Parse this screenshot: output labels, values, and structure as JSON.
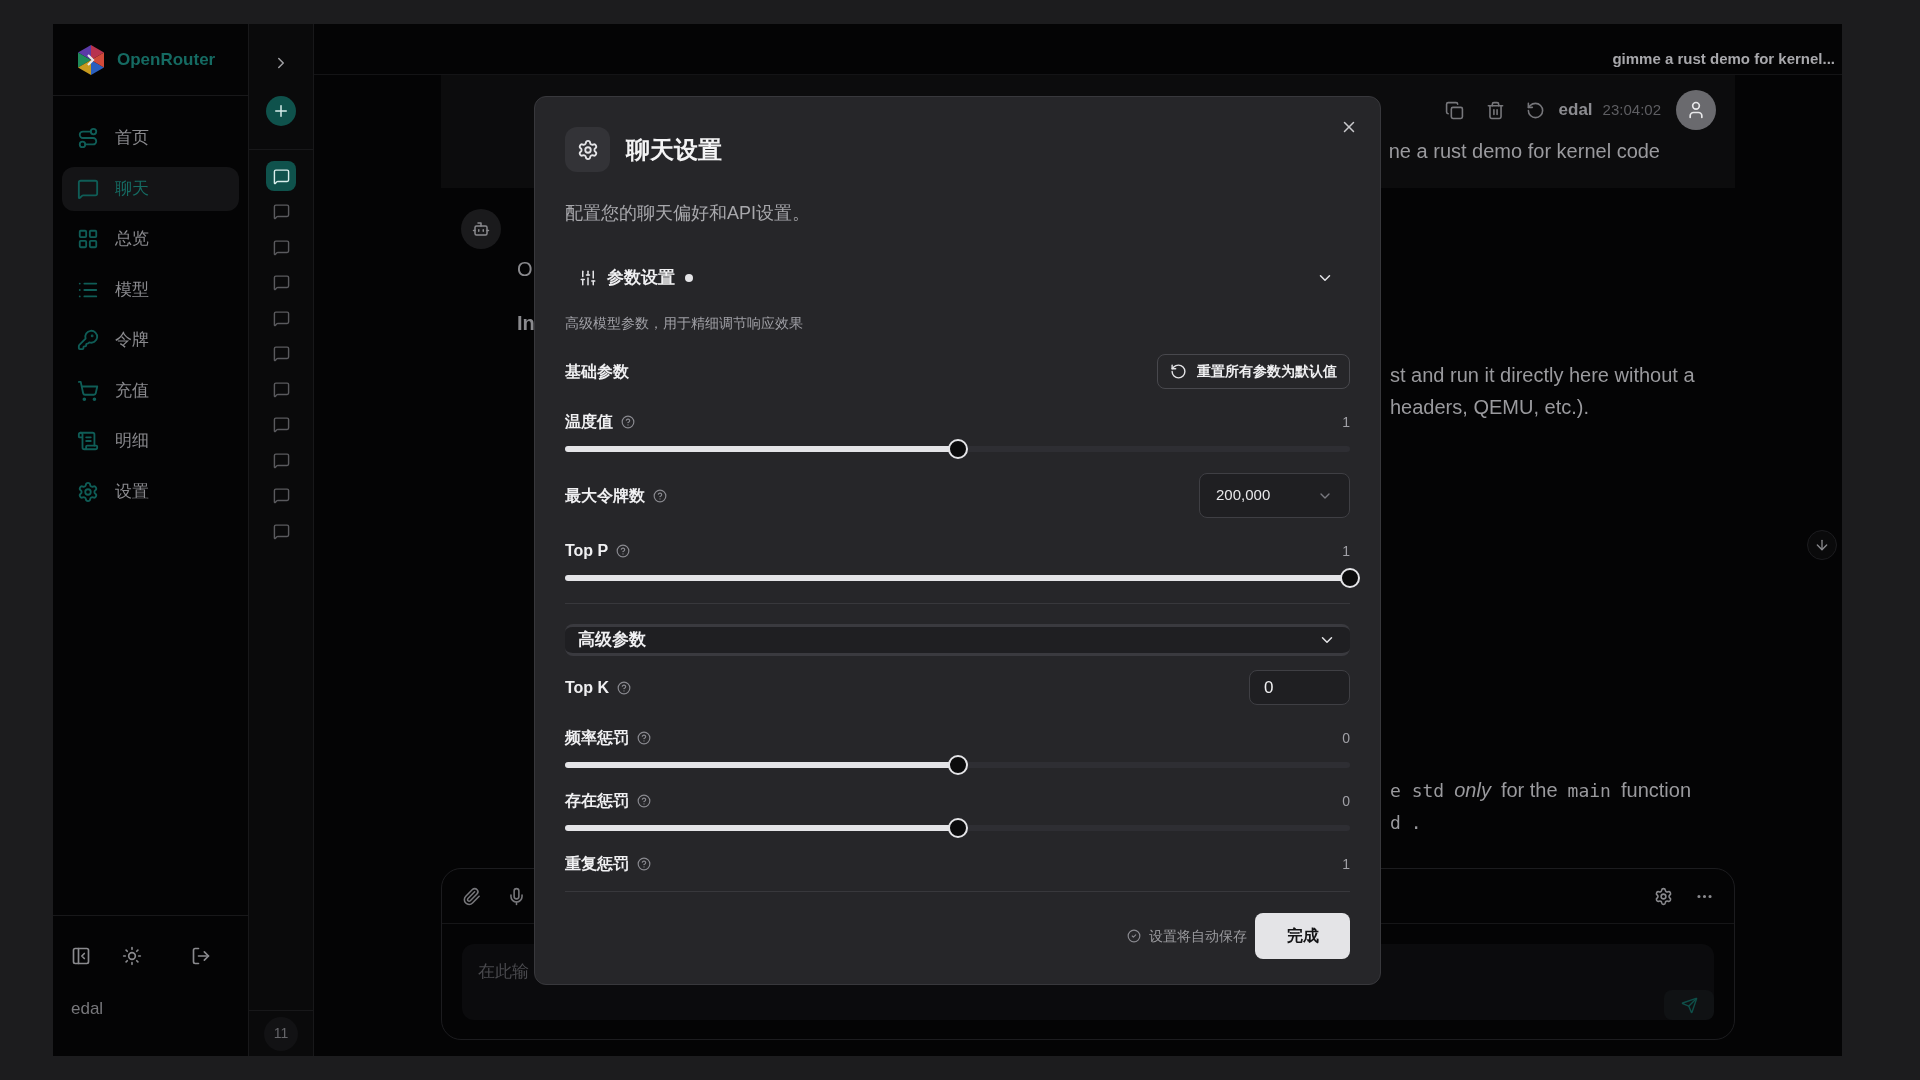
{
  "brand": "OpenRouter",
  "sidebar": {
    "items": [
      {
        "kind": "home",
        "label": "首页",
        "selected": false
      },
      {
        "kind": "chat",
        "label": "聊天",
        "selected": true
      },
      {
        "kind": "overview",
        "label": "总览",
        "selected": false
      },
      {
        "kind": "models",
        "label": "模型",
        "selected": false
      },
      {
        "kind": "tokens",
        "label": "令牌",
        "selected": false
      },
      {
        "kind": "topup",
        "label": "充值",
        "selected": false
      },
      {
        "kind": "details",
        "label": "明细",
        "selected": false
      },
      {
        "kind": "settings",
        "label": "设置",
        "selected": false
      }
    ],
    "user": "edal"
  },
  "chat_list": {
    "count": "11",
    "items": [
      {
        "selected": true
      },
      {
        "selected": false
      },
      {
        "selected": false
      },
      {
        "selected": false
      },
      {
        "selected": false
      },
      {
        "selected": false
      },
      {
        "selected": false
      },
      {
        "selected": false
      },
      {
        "selected": false
      },
      {
        "selected": false
      },
      {
        "selected": false
      }
    ]
  },
  "header": {
    "title": "gimme a rust demo for kernel..."
  },
  "user_message": {
    "author": "edal",
    "time": "23:04:02",
    "text": "ne a rust demo for kernel code"
  },
  "assistant_message": {
    "left_fragments": [
      {
        "kind": "text",
        "text": "O"
      },
      {
        "kind": "heading",
        "text": "In"
      }
    ],
    "blocks": [
      {
        "lines": [
          [
            {
              "kind": "text",
              "text": "st and run it directly here without a"
            }
          ],
          [
            {
              "kind": "text",
              "text": "headers, QEMU, etc.)."
            }
          ]
        ]
      },
      {
        "lines": [
          [
            {
              "kind": "code",
              "text": "e std"
            },
            {
              "kind": "italic",
              "text": "only"
            },
            {
              "kind": "text",
              "text": "for the"
            },
            {
              "kind": "code",
              "text": "main"
            },
            {
              "kind": "text",
              "text": "function"
            }
          ],
          [
            {
              "kind": "code",
              "text": "d"
            },
            {
              "kind": "code",
              "text": "."
            }
          ]
        ]
      }
    ]
  },
  "composer": {
    "placeholder": "在此输"
  },
  "dialog": {
    "title": "聊天设置",
    "description": "配置您的聊天偏好和API设置。",
    "section": {
      "title": "参数设置",
      "modified": true,
      "expanded": true,
      "subtitle": "高级模型参数，用于精细调节响应效果"
    },
    "basic": {
      "title": "基础参数",
      "reset_label": "重置所有参数为默认值",
      "params": [
        {
          "kind": "slider",
          "label": "温度值",
          "value": "1",
          "level": 0.5
        },
        {
          "kind": "select",
          "label": "最大令牌数",
          "value": "200,000"
        },
        {
          "kind": "slider",
          "label": "Top P",
          "value": "1",
          "level": 1
        }
      ]
    },
    "advanced": {
      "title": "高级参数",
      "expanded": true,
      "params": [
        {
          "kind": "number",
          "label": "Top K",
          "value": "0"
        },
        {
          "kind": "slider",
          "label": "频率惩罚",
          "value": "0",
          "level": 0.5
        },
        {
          "kind": "slider",
          "label": "存在惩罚",
          "value": "0",
          "level": 0.5
        },
        {
          "kind": "value",
          "label": "重复惩罚",
          "value": "1"
        }
      ]
    },
    "autosave_note": "设置将自动保存",
    "done_label": "完成"
  }
}
